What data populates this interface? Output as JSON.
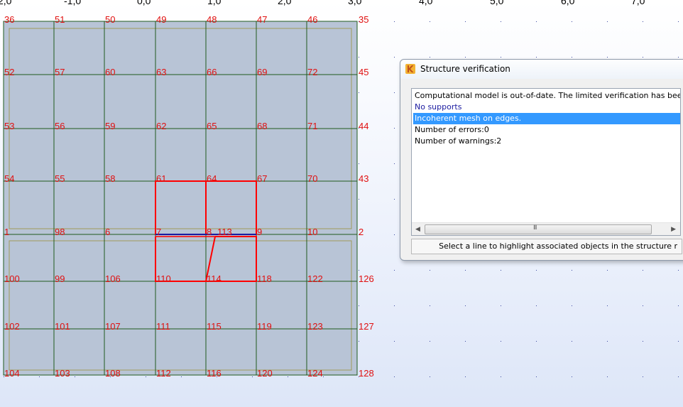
{
  "ruler": {
    "labels": [
      "2,0",
      "-1,0",
      "0,0",
      "1,0",
      "2,0",
      "3,0",
      "4,0",
      "5,0",
      "6,0",
      "7,0"
    ]
  },
  "nodes": {
    "row1": [
      "36",
      "51",
      "50",
      "49",
      "48",
      "47",
      "46",
      "35"
    ],
    "row2": [
      "52",
      "57",
      "60",
      "63",
      "66",
      "69",
      "72",
      "45"
    ],
    "row3": [
      "53",
      "56",
      "59",
      "62",
      "65",
      "68",
      "71",
      "44"
    ],
    "row4": [
      "54",
      "55",
      "58",
      "61",
      "64",
      "67",
      "70",
      "43"
    ],
    "row5": [
      "1",
      "98",
      "6",
      "7",
      "8",
      "113",
      "9",
      "10",
      "2"
    ],
    "row6": [
      "100",
      "99",
      "106",
      "110",
      "114",
      "118",
      "122",
      "126"
    ],
    "row7": [
      "102",
      "101",
      "107",
      "111",
      "115",
      "119",
      "123",
      "127"
    ],
    "row8": [
      "104",
      "103",
      "108",
      "112",
      "116",
      "120",
      "124",
      "128"
    ]
  },
  "colors": {
    "panel_fill": "#b8c4d6",
    "mesh_line": "#1f5a1f",
    "contour": "#a09a5a",
    "node_label": "#e01010",
    "highlight": "#ff0000",
    "edge_blue": "#1a1aa0",
    "selection": "#3399ff"
  },
  "dialog": {
    "icon": "app-k-icon",
    "title": "Structure verification",
    "messages": [
      {
        "text": "Computational model is out-of-date. The limited verification has been perform",
        "kind": "info"
      },
      {
        "text": "No supports",
        "kind": "warning"
      },
      {
        "text": "Incoherent mesh on edges.",
        "kind": "selected"
      },
      {
        "text": "Number of errors:0",
        "kind": "info"
      },
      {
        "text": "Number of warnings:2",
        "kind": "info"
      }
    ],
    "scrollbar": {
      "grip": "III",
      "left": "◀",
      "right": "▶"
    },
    "status": "Select a line to highlight associated objects in the structure r"
  }
}
